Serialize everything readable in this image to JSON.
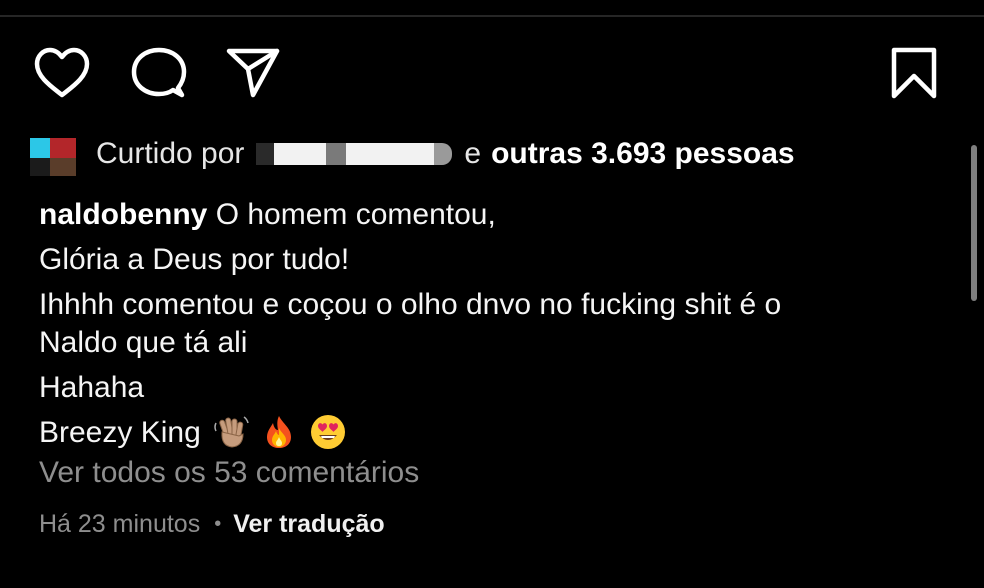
{
  "actions": {
    "like_icon": "heart-outline",
    "comment_icon": "speech-bubble",
    "share_icon": "paper-plane",
    "save_icon": "bookmark-outline"
  },
  "likes": {
    "prefix": "Curtido por",
    "conjunction": "e",
    "others": "outras 3.693 pessoas"
  },
  "caption": {
    "username": "naldobenny",
    "lines": [
      "O homem comentou,",
      "Glória a Deus por tudo!",
      "Ihhhh comentou e coçou o olho dnvo no fucking shit é o",
      "Naldo que tá ali",
      "Hahaha",
      "Breezy King"
    ],
    "emojis": [
      "waving-hand-medium-skin-tone",
      "fire",
      "smiling-face-with-heart-eyes"
    ]
  },
  "comments": {
    "view_all": "Ver todos os 53 comentários"
  },
  "meta": {
    "time": "Há 23 minutos",
    "separator": "•",
    "translate": "Ver tradução"
  },
  "colors": {
    "background": "#000000",
    "text": "#f5f5f5",
    "muted": "#8e8e8e",
    "scrollbar": "#7f7f7f"
  }
}
